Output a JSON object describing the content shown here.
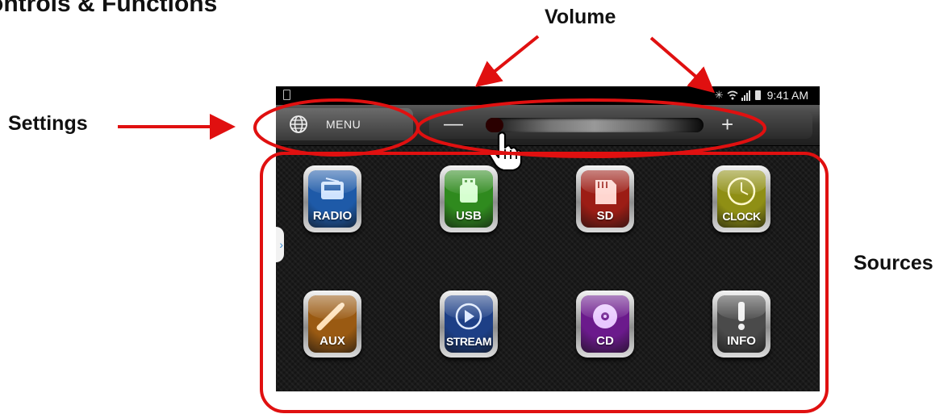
{
  "doc_title": "ontrols & Functions",
  "callouts": {
    "volume": "Volume",
    "settings": "Settings",
    "sources": "Sources"
  },
  "annotation_color": "#e01010",
  "statusbar": {
    "time": "9:41 AM",
    "icons": [
      "notification-icon",
      "bluetooth-icon",
      "wifi-icon",
      "signal-icon",
      "battery-icon"
    ]
  },
  "topbar": {
    "menu_label": "MENU",
    "menu_icon": "globe-icon",
    "volume_minus": "—",
    "volume_plus": "+",
    "volume_level": 0.08
  },
  "side_tab_glyph": "›",
  "sources": [
    {
      "key": "radio",
      "label": "RADIO",
      "color": "#1e5aa8"
    },
    {
      "key": "usb",
      "label": "USB",
      "color": "#2f8a1e"
    },
    {
      "key": "sd",
      "label": "SD",
      "color": "#9c1d15"
    },
    {
      "key": "clock",
      "label": "CLOCK",
      "color": "#8f8f14"
    },
    {
      "key": "aux",
      "label": "AUX",
      "color": "#9a5a12"
    },
    {
      "key": "stream",
      "label": "STREAM",
      "color": "#1d3f86"
    },
    {
      "key": "cd",
      "label": "CD",
      "color": "#6b1a8c"
    },
    {
      "key": "info",
      "label": "INFO",
      "color": "#4a4a4a"
    }
  ]
}
